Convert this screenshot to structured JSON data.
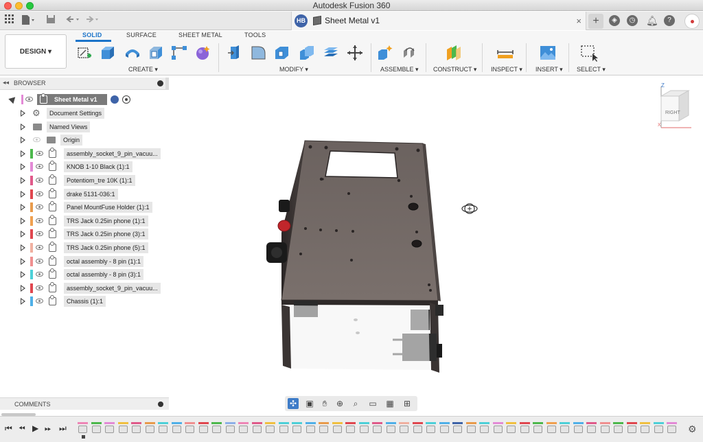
{
  "window": {
    "title": "Autodesk Fusion 360"
  },
  "tabbar": {
    "avatar_initials": "HB",
    "document_title": "Sheet Metal v1",
    "close_glyph": "×",
    "new_tab_glyph": "+"
  },
  "toolbar": {
    "workspace": "DESIGN ▾",
    "tabs": [
      "SOLID",
      "SURFACE",
      "SHEET METAL",
      "TOOLS"
    ],
    "groups": [
      "CREATE ▾",
      "MODIFY ▾",
      "ASSEMBLE ▾",
      "CONSTRUCT ▾",
      "INSPECT ▾",
      "INSERT ▾",
      "SELECT ▾"
    ]
  },
  "browser": {
    "title": "BROWSER",
    "root": "Sheet Metal v1",
    "items": [
      {
        "label": "Document Settings",
        "kind": "settings",
        "color": ""
      },
      {
        "label": "Named Views",
        "kind": "folder",
        "color": ""
      },
      {
        "label": "Origin",
        "kind": "folder",
        "color": ""
      },
      {
        "label": "assembly_socket_9_pin_vacuu...",
        "kind": "component",
        "color": "#4cb84c"
      },
      {
        "label": "KNOB 1-10 Black (1):1",
        "kind": "component",
        "color": "#e38ad6"
      },
      {
        "label": "Potentiom_tre 10K (1):1",
        "kind": "component",
        "color": "#e05a8a"
      },
      {
        "label": "drake 5131-036:1",
        "kind": "component",
        "color": "#e0474f"
      },
      {
        "label": "Panel MountFuse Holder (1):1",
        "kind": "component",
        "color": "#e89b4c"
      },
      {
        "label": "TRS Jack 0.25in phone (1):1",
        "kind": "component",
        "color": "#f0a050"
      },
      {
        "label": "TRS Jack 0.25in phone (3):1",
        "kind": "component",
        "color": "#e0474f"
      },
      {
        "label": "TRS Jack 0.25in phone (5):1",
        "kind": "component",
        "color": "#f0b0a0"
      },
      {
        "label": "octal assembly - 8 pin (1):1",
        "kind": "component",
        "color": "#f09090"
      },
      {
        "label": "octal assembly - 8 pin (3):1",
        "kind": "component",
        "color": "#4dd0d8"
      },
      {
        "label": "assembly_socket_9_pin_vacuu...",
        "kind": "component",
        "color": "#e0474f"
      },
      {
        "label": "Chassis (1):1",
        "kind": "component",
        "color": "#4fb0e8"
      }
    ]
  },
  "comments": {
    "title": "COMMENTS"
  },
  "viewcube": {
    "face_label": "RIGHT",
    "axis_z": "Z",
    "axis_x": "X"
  },
  "timeline": {
    "stripe_colors": [
      "#ee86b6",
      "#4cb84c",
      "#e38ad6",
      "#f0c040",
      "#e05a8a",
      "#e89b4c",
      "#4dd0d8",
      "#4fb0e8",
      "#f09090",
      "#e0474f",
      "#4cb84c",
      "#8db0e8",
      "#ee86b6",
      "#e05a8a",
      "#f0c040",
      "#4dd0d8",
      "#4dd0d8",
      "#4fb0e8",
      "#e89b4c",
      "#f0c040",
      "#e0474f",
      "#4dd0d8",
      "#e05a8a",
      "#4fb0e8",
      "#f0b0a0",
      "#e0474f",
      "#4dd0d8",
      "#4fb0e8",
      "#3e63a8",
      "#e89b4c",
      "#4dd0d8",
      "#e38ad6",
      "#f0c040",
      "#e0474f",
      "#4cb84c",
      "#f0a050",
      "#4dd0d8",
      "#4fb0e8",
      "#e05a8a",
      "#f09090",
      "#4cb84c",
      "#e0474f",
      "#f0c040",
      "#4dd0d8",
      "#e38ad6"
    ]
  }
}
